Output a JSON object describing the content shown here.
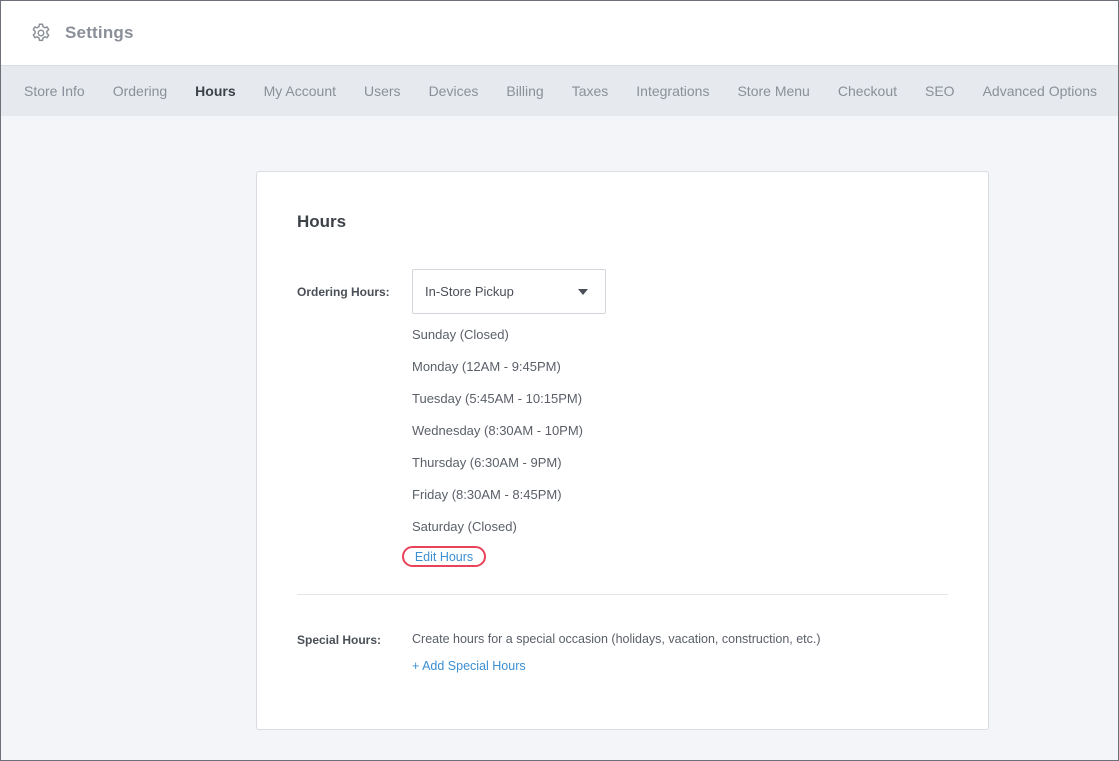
{
  "header": {
    "title": "Settings",
    "icon": "gear-icon"
  },
  "tabs": [
    {
      "label": "Store Info",
      "active": false
    },
    {
      "label": "Ordering",
      "active": false
    },
    {
      "label": "Hours",
      "active": true
    },
    {
      "label": "My Account",
      "active": false
    },
    {
      "label": "Users",
      "active": false
    },
    {
      "label": "Devices",
      "active": false
    },
    {
      "label": "Billing",
      "active": false
    },
    {
      "label": "Taxes",
      "active": false
    },
    {
      "label": "Integrations",
      "active": false
    },
    {
      "label": "Store Menu",
      "active": false
    },
    {
      "label": "Checkout",
      "active": false
    },
    {
      "label": "SEO",
      "active": false
    },
    {
      "label": "Advanced Options",
      "active": false
    }
  ],
  "card": {
    "title": "Hours",
    "ordering_hours": {
      "label": "Ordering Hours:",
      "select_value": "In-Store Pickup",
      "days": [
        "Sunday (Closed)",
        "Monday (12AM - 9:45PM)",
        "Tuesday (5:45AM - 10:15PM)",
        "Wednesday (8:30AM - 10PM)",
        "Thursday (6:30AM - 9PM)",
        "Friday (8:30AM - 8:45PM)",
        "Saturday (Closed)"
      ],
      "edit_link": "Edit Hours"
    },
    "special_hours": {
      "label": "Special Hours:",
      "description": "Create hours for a special occasion (holidays, vacation, construction, etc.)",
      "add_link": "+ Add Special Hours"
    }
  },
  "colors": {
    "link": "#3b8fd3",
    "highlight": "#e8435a",
    "tab_bar": "#e6e9ee",
    "page_bg": "#f4f5f8"
  }
}
